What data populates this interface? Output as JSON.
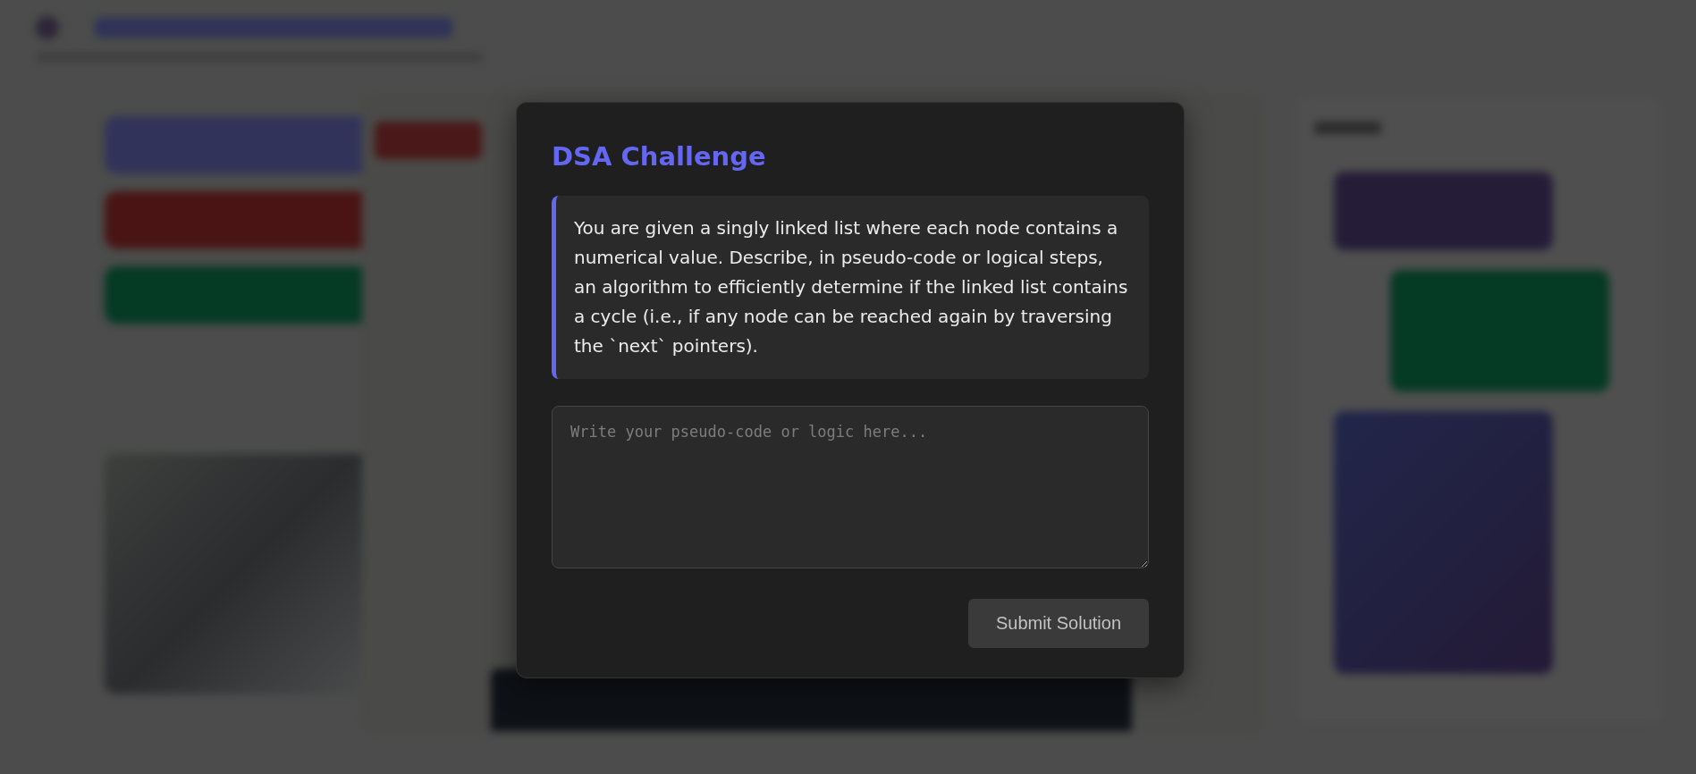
{
  "dialog": {
    "title": "DSA Challenge",
    "prompt": "You are given a singly linked list where each node contains a numerical value. Describe, in pseudo-code or logical steps, an algorithm to efficiently determine if the linked list contains a cycle (i.e., if any node can be reached again by traversing the `next` pointers).",
    "answer": {
      "placeholder": "Write your pseudo-code or logic here..."
    },
    "submit_button": "Submit Solution"
  }
}
